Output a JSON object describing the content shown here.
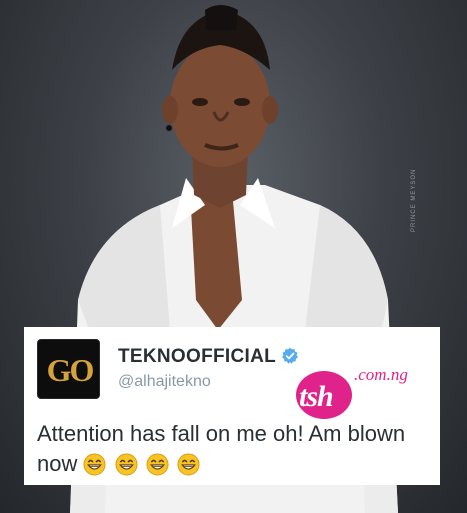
{
  "photo": {
    "watermark_text": "PRINCE MEYSON",
    "shirt_color": "#f4f4f4",
    "background_color": "#3a3e44"
  },
  "tweet": {
    "avatar_logo_text": "GO",
    "display_name": "TEKNOOFFICIAL",
    "handle": "@alhajitekno",
    "verified_icon": "verified-badge-icon",
    "body_text": "Attention has fall on me oh! Am blown now",
    "emojis": [
      "grinning-face-icon",
      "grinning-face-icon",
      "grinning-face-icon",
      "grinning-face-icon"
    ]
  },
  "site_logo": {
    "mark": "tsh",
    "domain": ".com.ng",
    "accent_color": "#e0238b"
  }
}
